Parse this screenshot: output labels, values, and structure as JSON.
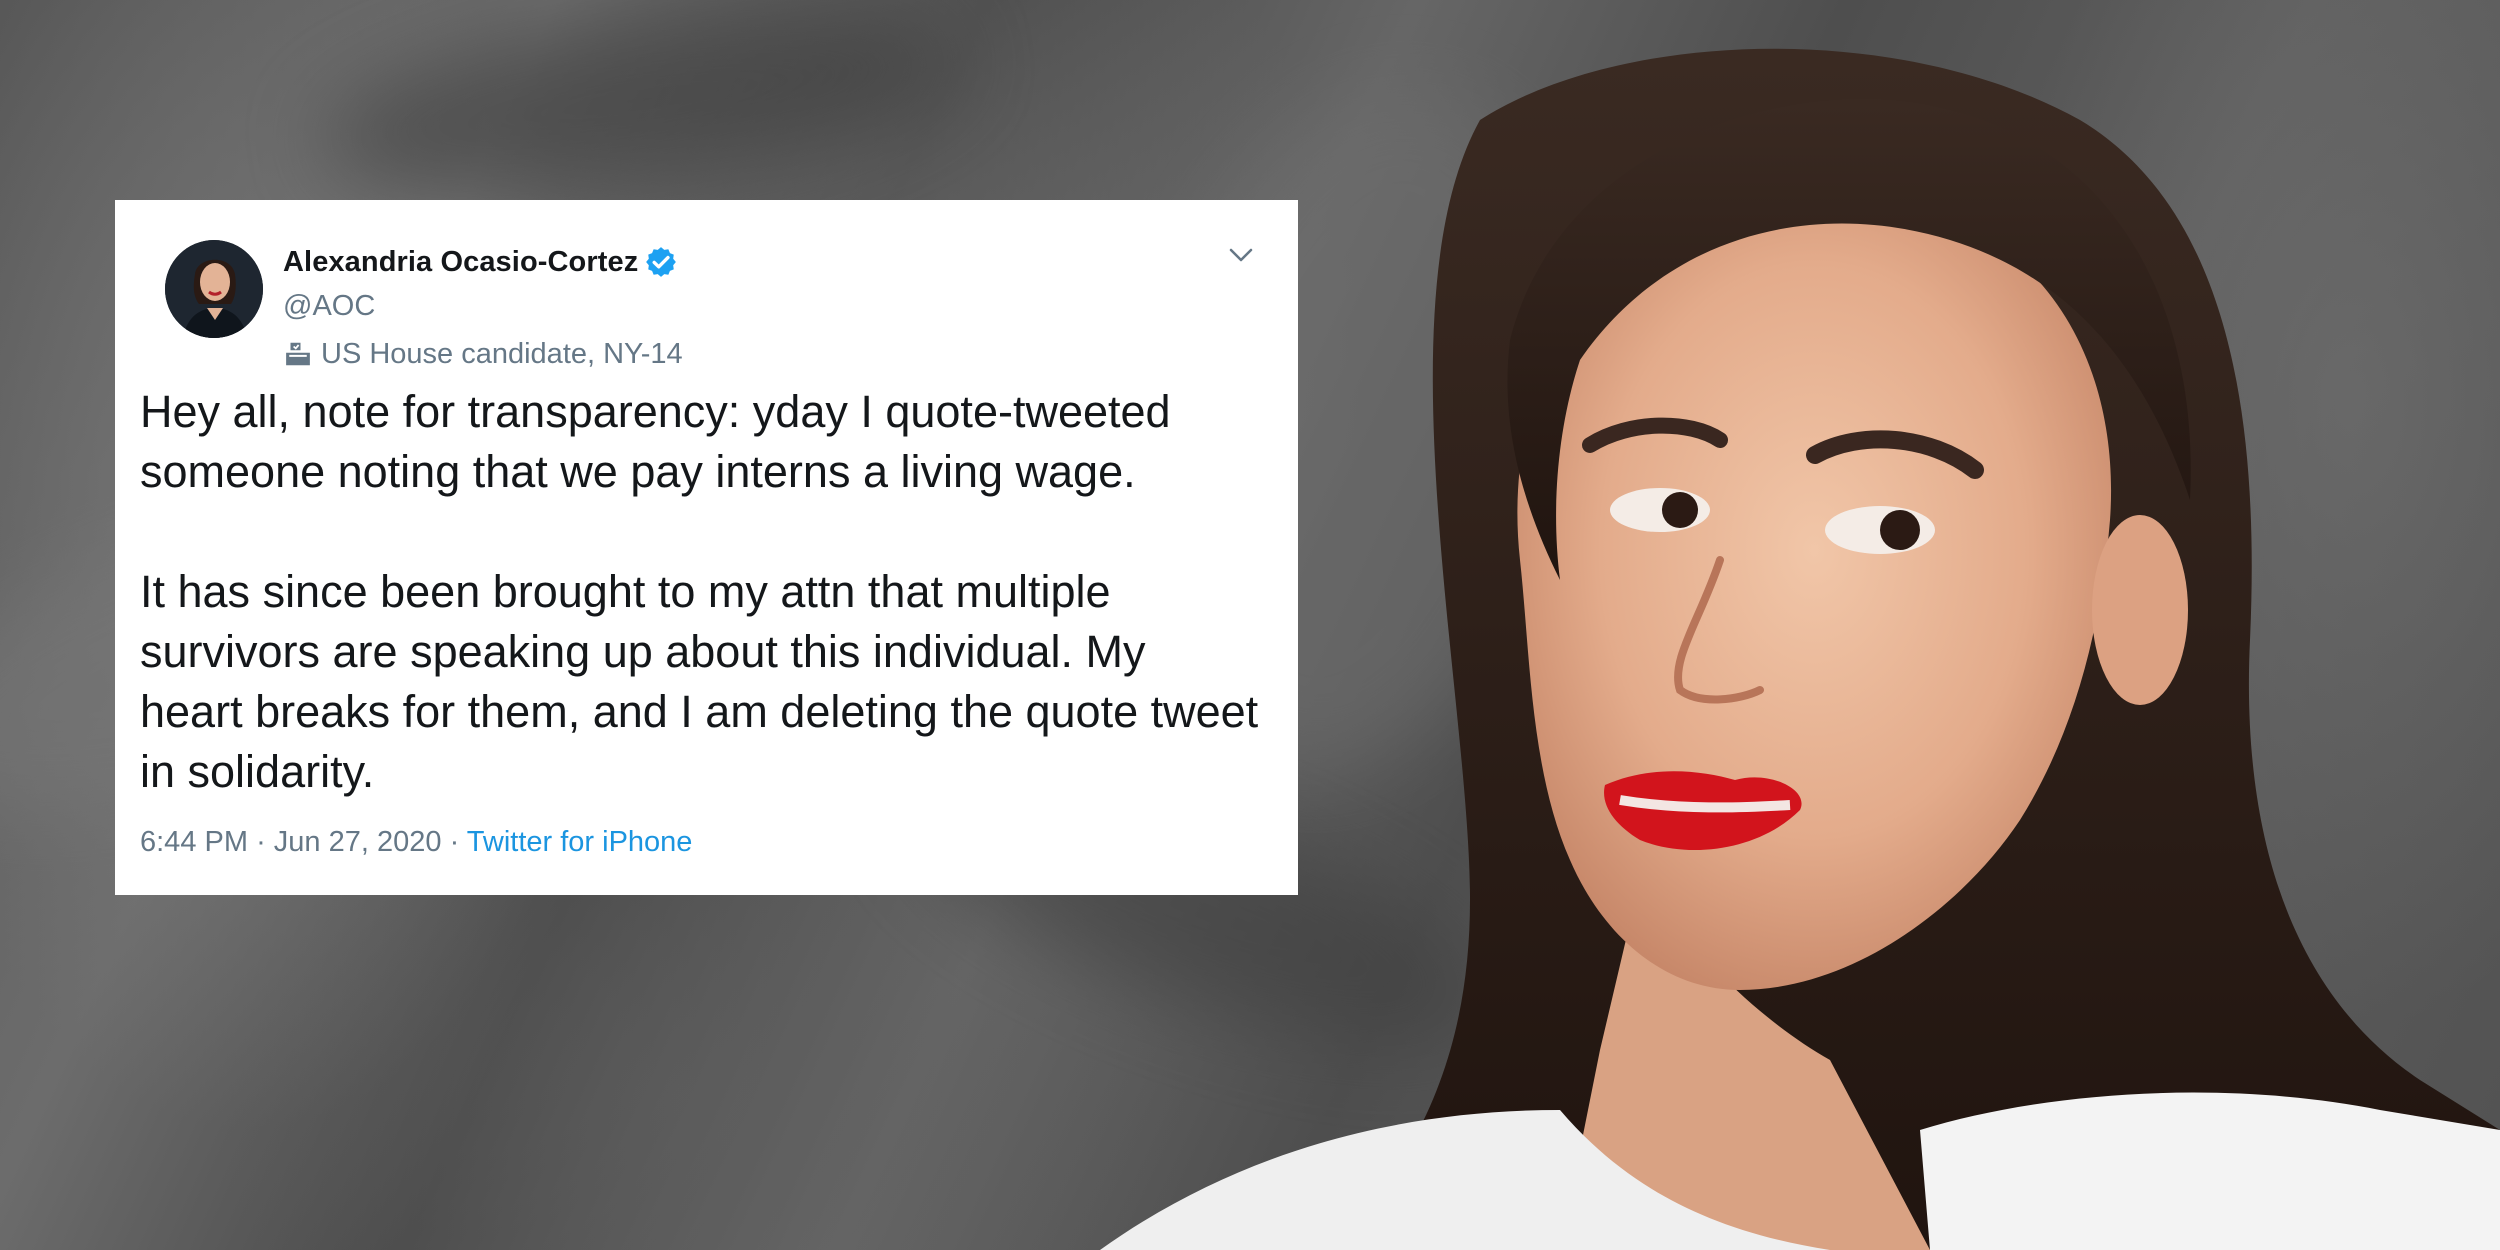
{
  "tweet": {
    "author_name": "Alexandria Ocasio-Cortez",
    "handle": "@AOC",
    "bio_label": "US House candidate, NY-14",
    "paragraphs": [
      "Hey all, note for transparency: yday I quote-tweeted someone noting that we pay interns a living wage.",
      "It has since been brought to my attn that multiple survivors are speaking up about this individual. My heart breaks for them, and I am deleting the quote tweet in solidarity."
    ],
    "time": "6:44 PM",
    "separator": "·",
    "date": "Jun 27, 2020",
    "source": "Twitter for iPhone"
  },
  "icons": {
    "verified": "verified-badge-icon",
    "ballot": "ballot-box-icon",
    "menu": "chevron-down-icon"
  },
  "colors": {
    "verified_blue": "#1da1f2",
    "text_primary": "#14171a",
    "text_secondary": "#657786",
    "link": "#1b95e0"
  }
}
